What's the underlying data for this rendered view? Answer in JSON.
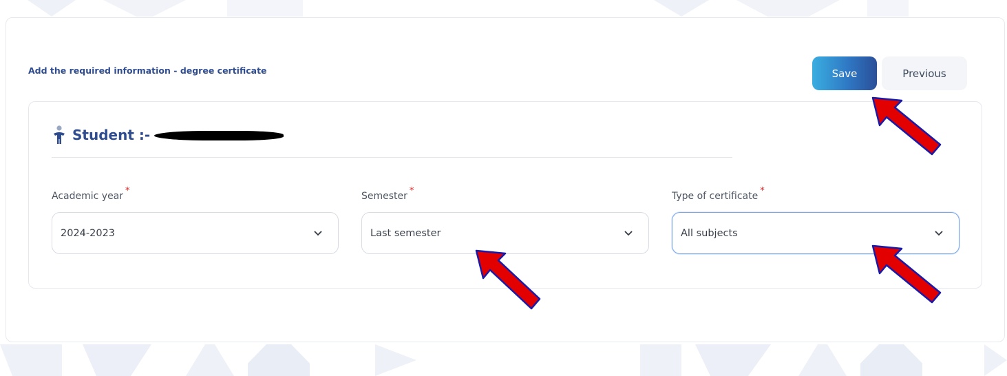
{
  "header": {
    "title": "Add the required information - degree certificate",
    "save_label": "Save",
    "previous_label": "Previous"
  },
  "student": {
    "label": "Student :-"
  },
  "form": {
    "fields": [
      {
        "label": "Academic year",
        "required_mark": "*",
        "value": "2024-2023"
      },
      {
        "label": "Semester",
        "required_mark": "*",
        "value": "Last semester"
      },
      {
        "label": "Type of certificate",
        "required_mark": "*",
        "value": "All subjects"
      }
    ]
  },
  "colors": {
    "primary_text": "#2f4c8f",
    "save_gradient_start": "#3aaee0",
    "save_gradient_end": "#2b4f98",
    "required": "#e02424",
    "annotation_arrow": "#e30000"
  }
}
